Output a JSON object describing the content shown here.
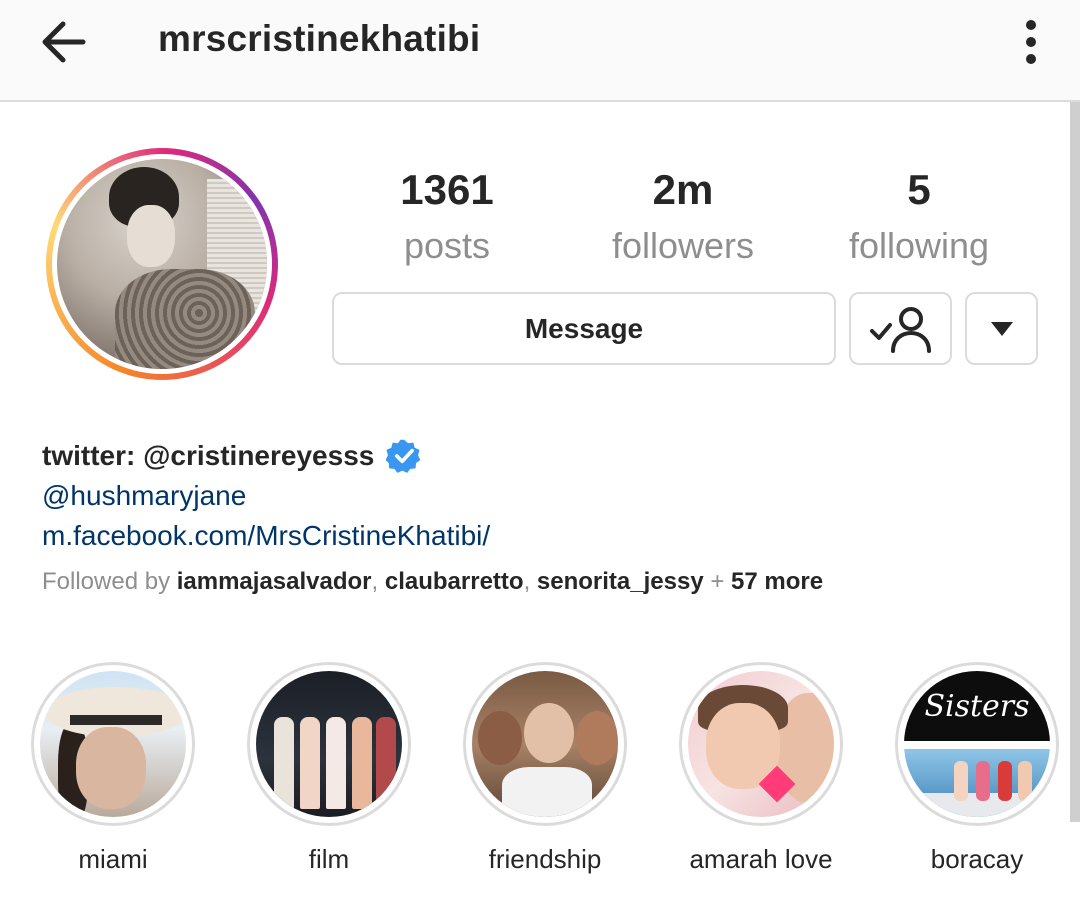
{
  "topbar": {
    "username": "mrscristinekhatibi",
    "back_icon": "arrow-left-icon",
    "more_icon": "more-vertical-icon"
  },
  "stats": [
    {
      "value": "1361",
      "label": "posts"
    },
    {
      "value": "2m",
      "label": "followers"
    },
    {
      "value": "5",
      "label": "following"
    }
  ],
  "actions": {
    "message_label": "Message",
    "following_icon": "user-check-icon",
    "dropdown_icon": "triangle-down-icon"
  },
  "bio": {
    "name": "twitter: @cristinereyesss",
    "verified": true,
    "links": [
      "@hushmaryjane",
      "m.facebook.com/MrsCristineKhatibi/"
    ],
    "followed_by_prefix": "Followed by",
    "followed_by_users": [
      "iammajasalvador",
      "claubarretto",
      "senorita_jessy"
    ],
    "followed_by_sep": ",",
    "followed_by_plus": "+",
    "followed_by_more": "57 more"
  },
  "highlights": [
    {
      "label": "miami"
    },
    {
      "label": "film"
    },
    {
      "label": "friendship"
    },
    {
      "label": "amarah love"
    },
    {
      "label": "boracay",
      "cover_text": "Sisters"
    }
  ],
  "colors": {
    "link": "#003569",
    "muted": "#8e8e8e",
    "verified_blue": "#3897f0",
    "border": "#dbdbdb"
  }
}
